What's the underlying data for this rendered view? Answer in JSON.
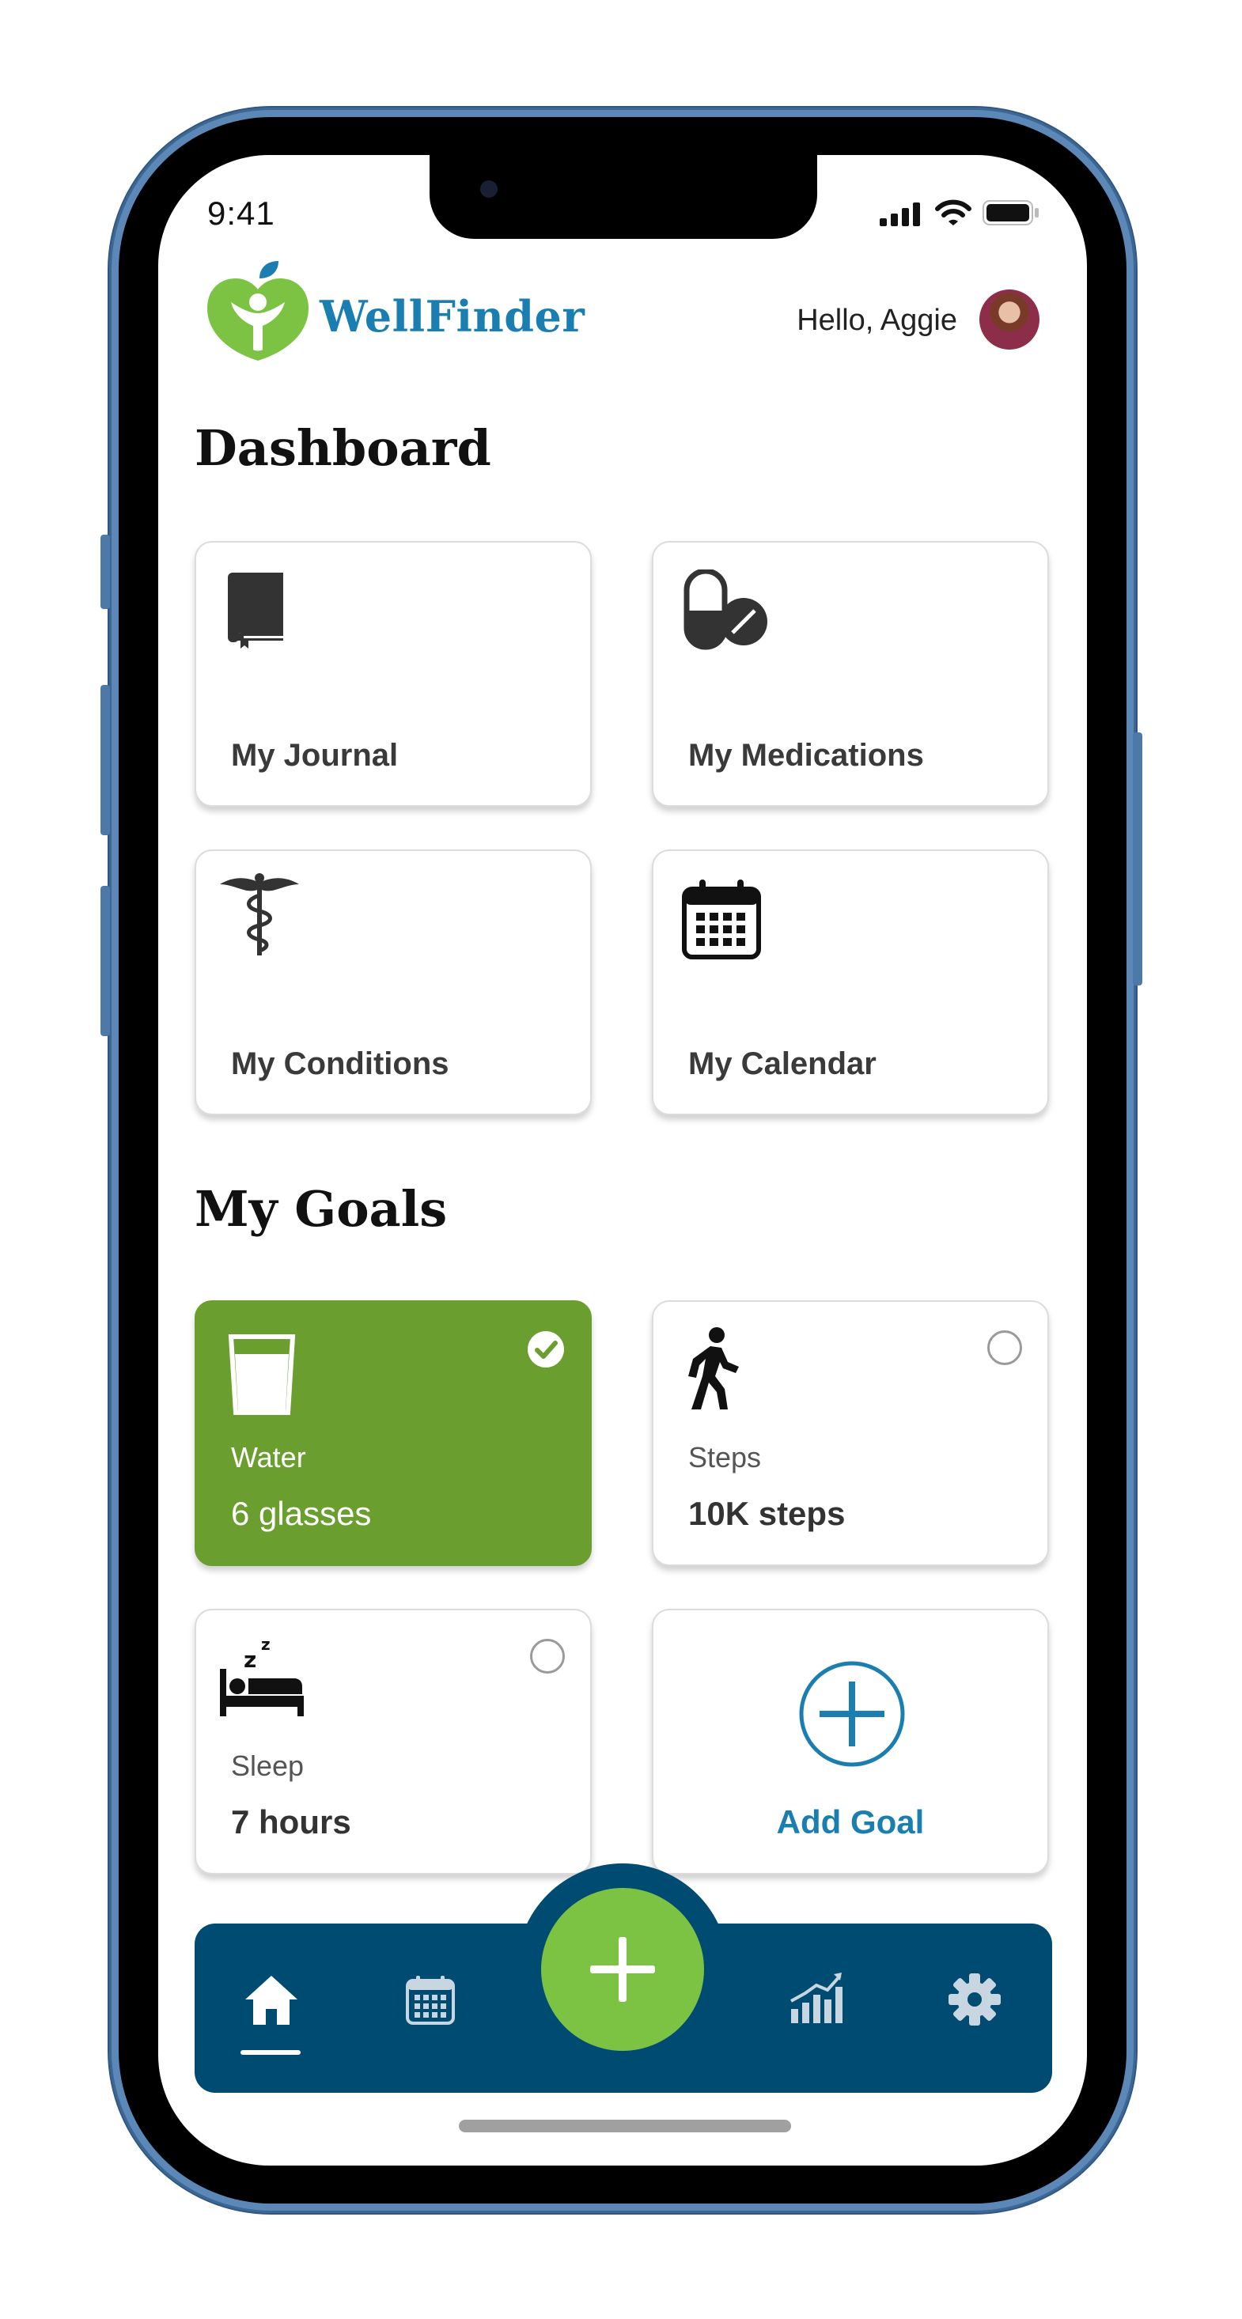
{
  "status_bar": {
    "time": "9:41"
  },
  "header": {
    "app_name": "WellFinder",
    "greeting": "Hello, Aggie"
  },
  "dashboard": {
    "title": "Dashboard",
    "tiles": [
      {
        "label": "My Journal",
        "icon": "journal-book-icon"
      },
      {
        "label": "My Medications",
        "icon": "pill-icon"
      },
      {
        "label": "My Conditions",
        "icon": "caduceus-icon"
      },
      {
        "label": "My Calendar",
        "icon": "calendar-icon"
      }
    ]
  },
  "goals": {
    "title": "My Goals",
    "items": [
      {
        "type": "Water",
        "value": "6 glasses",
        "completed": true,
        "icon": "water-glass-icon"
      },
      {
        "type": "Steps",
        "value": "10K steps",
        "completed": false,
        "icon": "walking-icon"
      },
      {
        "type": "Sleep",
        "value": "7 hours",
        "completed": false,
        "icon": "sleep-bed-icon"
      }
    ],
    "add_label": "Add Goal"
  },
  "nav": {
    "items": [
      "home-icon",
      "calendar-icon",
      "add-icon",
      "chart-icon",
      "settings-icon"
    ],
    "active": "home"
  },
  "colors": {
    "brand_blue": "#1a7fb0",
    "nav_bg": "#004b71",
    "fab_green": "#7cc243",
    "goal_done_green": "#6a9e2e",
    "logo_green": "#7cc243"
  }
}
